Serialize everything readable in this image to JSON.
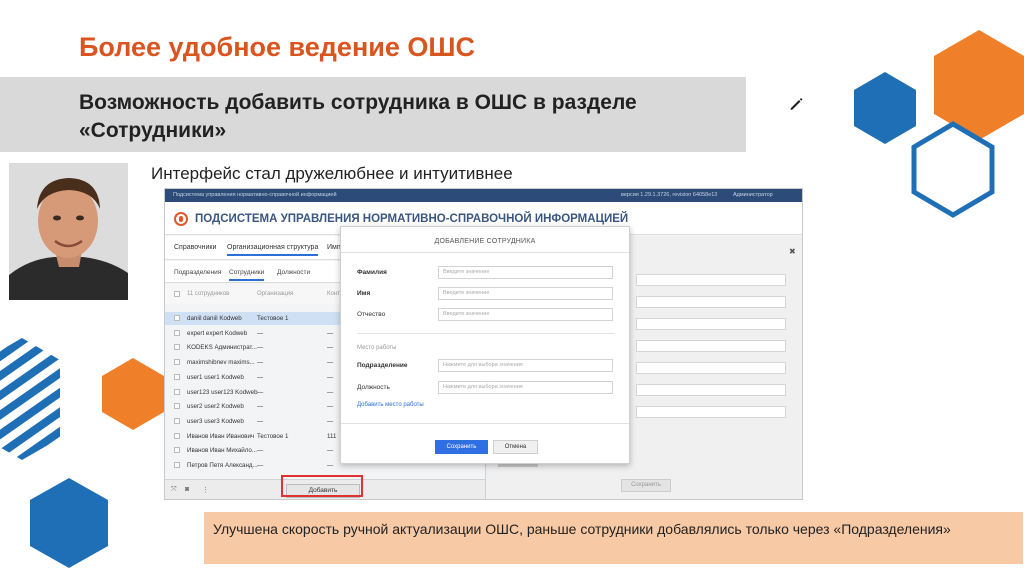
{
  "slide": {
    "title": "Более удобное ведение ОШС",
    "subtitle": "Возможность добавить сотрудника в ОШС в разделе «Сотрудники»",
    "caption": "Интерфейс стал дружелюбнее и интуитивнее",
    "note": "Улучшена скорость ручной актуализации ОШС, раньше сотрудники добавлялись только через «Подразделения»"
  },
  "colors": {
    "title_orange": "#d9541e",
    "hex_orange": "#f07f2a",
    "hex_blue": "#1f6fb6",
    "note_bg": "#f8c9a5",
    "band_gray": "#d9d9d9",
    "highlight_red": "#e03232"
  },
  "icons": [
    "pencil-icon",
    "logo-icon",
    "checkbox-icon",
    "close-icon",
    "camera-icon",
    "more-icon"
  ],
  "app": {
    "topbar_left": "Подсистема управления нормативно-справочной информацией",
    "version": "версия 1.29.1.3726, revision 64058e13",
    "user": "Администратор",
    "system_name": "ПОДСИСТЕМА УПРАВЛЕНИЯ НОРМАТИВНО-СПРАВОЧНОЙ ИНФОРМАЦИЕЙ",
    "menu": [
      "Справочники",
      "Организационная структура",
      "Имп"
    ],
    "subtabs": [
      "Подразделения",
      "Сотрудники",
      "Должности"
    ],
    "list_header": {
      "count": "11 сотрудников",
      "col_org": "Организация",
      "col_more": "Конт"
    },
    "rows": [
      {
        "name": "daniil daniil Kodweb",
        "org": "Тестовое 1",
        "extra": ""
      },
      {
        "name": "expert expert Kodweb",
        "org": "—",
        "extra": "—"
      },
      {
        "name": "KODEKS Администрат...",
        "org": "—",
        "extra": "—"
      },
      {
        "name": "maximshibnev maxims...",
        "org": "—",
        "extra": "—"
      },
      {
        "name": "user1 user1 Kodweb",
        "org": "—",
        "extra": "—"
      },
      {
        "name": "user123 user123 Kodweb",
        "org": "—",
        "extra": "—"
      },
      {
        "name": "user2 user2 Kodweb",
        "org": "—",
        "extra": "—"
      },
      {
        "name": "user3 user3 Kodweb",
        "org": "—",
        "extra": "—"
      },
      {
        "name": "Иванов Иван Иванович",
        "org": "Тестовое 1",
        "extra": "111"
      },
      {
        "name": "Иванов Иван Михайло...",
        "org": "—",
        "extra": "—"
      },
      {
        "name": "Петров Петя Александ...",
        "org": "—",
        "extra": "—"
      }
    ],
    "add_button": "Добавить",
    "right_save": "Сохранить"
  },
  "modal": {
    "title": "ДОБАВЛЕНИЕ СОТРУДНИКА",
    "lastname_label": "Фамилия",
    "firstname_label": "Имя",
    "middlename_label": "Отчество",
    "input_placeholder": "Введите значение",
    "workplace_section": "Место работы",
    "department_label": "Подразделение",
    "position_label": "Должность",
    "select_placeholder": "Нажмите для выбора значения",
    "add_workplace_link": "Добавить место работы",
    "save_button": "Сохранить",
    "cancel_button": "Отмена"
  }
}
